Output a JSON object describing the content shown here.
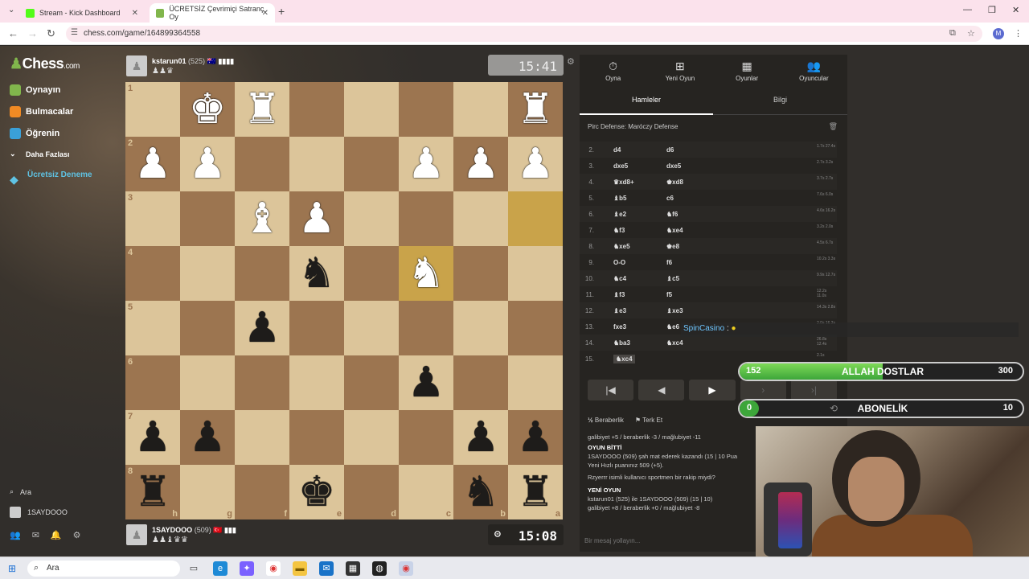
{
  "browser": {
    "tabs": [
      {
        "title": "Stream - Kick Dashboard",
        "active": false
      },
      {
        "title": "ÜCRETSİZ Çevrimiçi Satranç Oy",
        "active": true
      }
    ],
    "new_tab": "+",
    "url": "chess.com/game/164899364558",
    "profile_initial": "M"
  },
  "sidebar": {
    "logo": "Chess",
    "logo_suffix": ".com",
    "items": [
      {
        "label": "Oynayın",
        "color": "#81b64c"
      },
      {
        "label": "Bulmacalar",
        "color": "#f08a24"
      },
      {
        "label": "Öğrenin",
        "color": "#3aa0d8"
      },
      {
        "label": "Daha Fazlası",
        "color": "#666"
      }
    ],
    "trial": "Ücretsiz Deneme",
    "search": "Ara",
    "user": "1SAYDOOO"
  },
  "top_player": {
    "name": "kstarun01",
    "rating": "(525)",
    "flag": "🇦🇺",
    "bars": "▮▮▮▮",
    "captured": "♟♟♛",
    "clock": "15:41"
  },
  "bottom_player": {
    "name": "1SAYDOOO",
    "rating": "(509)",
    "flag": "🇹🇷",
    "bars": "▮▮▮",
    "captured": "♟♟♝♛♛",
    "clock": "15:08"
  },
  "board": {
    "ranks": [
      "1",
      "2",
      "3",
      "4",
      "5",
      "6",
      "7",
      "8"
    ],
    "files": [
      "h",
      "g",
      "f",
      "e",
      "d",
      "c",
      "b",
      "a"
    ],
    "highlight": [
      [
        2,
        7
      ],
      [
        3,
        5
      ]
    ],
    "rows": [
      [
        "",
        "wK",
        "wR",
        "",
        "",
        "",
        "",
        "wR"
      ],
      [
        "wP",
        "wP",
        "",
        "",
        "",
        "wP",
        "wP",
        "wP"
      ],
      [
        "",
        "",
        "wB",
        "wP",
        "",
        "",
        "",
        ""
      ],
      [
        "",
        "",
        "",
        "bN",
        "",
        "wN",
        "",
        ""
      ],
      [
        "",
        "",
        "bP",
        "",
        "",
        "",
        "",
        ""
      ],
      [
        "",
        "",
        "",
        "",
        "",
        "bP",
        "",
        ""
      ],
      [
        "bP",
        "bP",
        "",
        "",
        "",
        "",
        "bP",
        "bP"
      ],
      [
        "bR",
        "",
        "",
        "bK",
        "",
        "",
        "bN",
        "bR"
      ]
    ]
  },
  "panel": {
    "tabs": [
      {
        "label": "Oyna",
        "icon": "⏱"
      },
      {
        "label": "Yeni Oyun",
        "icon": "⊞"
      },
      {
        "label": "Oyunlar",
        "icon": "▦"
      },
      {
        "label": "Oyuncular",
        "icon": "👥"
      }
    ],
    "subtab_moves": "Hamleler",
    "subtab_info": "Bilgi",
    "opening": "Pirc Defense: Maróczy Defense",
    "moves": [
      {
        "n": "2.",
        "w": "d4",
        "b": "d6",
        "t": "1.7s 27.4s"
      },
      {
        "n": "3.",
        "w": "dxe5",
        "b": "dxe5",
        "t": "2.7s 3.2s"
      },
      {
        "n": "4.",
        "w": "♛xd8+",
        "b": "♚xd8",
        "t": "3.7s 2.7s"
      },
      {
        "n": "5.",
        "w": "♝b5",
        "b": "c6",
        "t": "7.6s 6.0s"
      },
      {
        "n": "6.",
        "w": "♝e2",
        "b": "♞f6",
        "t": "4.6s 16.2s"
      },
      {
        "n": "7.",
        "w": "♞f3",
        "b": "♞xe4",
        "t": "3.2s 2.0s"
      },
      {
        "n": "8.",
        "w": "♞xe5",
        "b": "♚e8",
        "t": "4.5s 6.7s"
      },
      {
        "n": "9.",
        "w": "O-O",
        "b": "f6",
        "t": "10.2s 3.3s"
      },
      {
        "n": "10.",
        "w": "♞c4",
        "b": "♝c5",
        "t": "9.9s 12.7s"
      },
      {
        "n": "11.",
        "w": "♝f3",
        "b": "f5",
        "t": "12.2s 11.0s"
      },
      {
        "n": "12.",
        "w": "♝e3",
        "b": "♝xe3",
        "t": "14.3s 2.8s"
      },
      {
        "n": "13.",
        "w": "fxe3",
        "b": "♞e6",
        "t": "2.0s 16.3s"
      },
      {
        "n": "14.",
        "w": "♞ba3",
        "b": "♞xc4",
        "t": "26.8s 12.4s"
      },
      {
        "n": "15.",
        "w": "♞xc4",
        "b": "",
        "t": "2.1s"
      }
    ],
    "draw": "Beraberlik",
    "resign": "Terk Et",
    "log": {
      "stats1": "galibiyet +5 / beraberlik -3 / mağlubiyet -11",
      "over_title": "OYUN BİTTİ",
      "over_text": "1SAYDOOO (509) şah mat ederek kazandı (15 | 10 Pua",
      "rating_line": "Yeni Hızlı puanınız 509 (+5).",
      "sportsman": "Rzyerrr isimli kullanıcı sportmen bir rakip miydi?",
      "new_title": "YENİ OYUN",
      "new_text": "kstarun01 (525) ile 1SAYDOOO (509) (15 | 10)",
      "stats2": "galibiyet +8 / beraberlik +0 / mağlubiyet -8"
    },
    "message_placeholder": "Bir mesaj yollayın..."
  },
  "overlay": {
    "chat_user": "SpinCasino",
    "chat_sep": ":",
    "goal1": {
      "left": "152",
      "label": "ALLAH DOSTLAR",
      "right": "300",
      "progress": 0.507
    },
    "goal2": {
      "left": "0",
      "label": "ABONELİK",
      "right": "10",
      "progress": 0.0
    }
  },
  "taskbar": {
    "search": "Ara"
  }
}
